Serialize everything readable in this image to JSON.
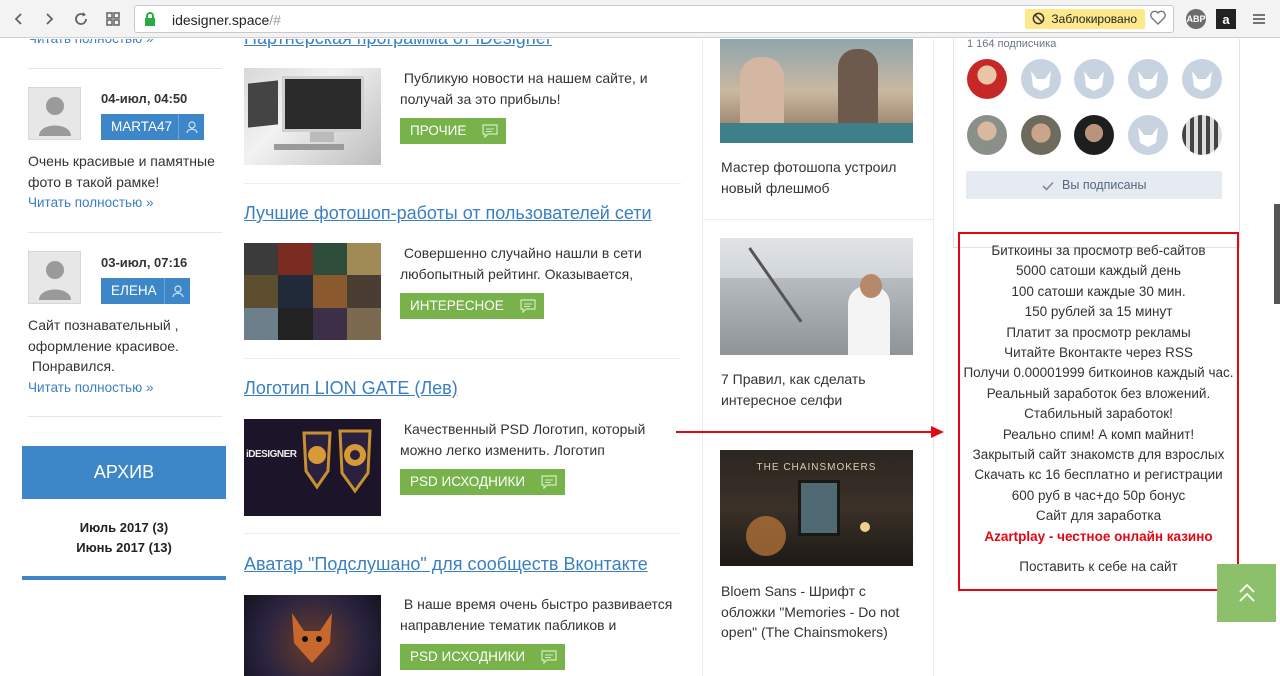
{
  "browser": {
    "url_host": "idesigner.space",
    "url_path": "/#",
    "blocked_label": "Заблокировано",
    "ext_abp": "ABP",
    "ext_amazon": "a"
  },
  "left": {
    "read_more": "Читать полностью »",
    "comments": [
      {
        "date": "04-июл, 04:50",
        "user": "MARTA47",
        "text_lines": [
          "Очень красивые и памятные",
          "фото в такой рамке!"
        ]
      },
      {
        "date": "03-июл, 07:16",
        "user": "ЕЛЕНА",
        "text_lines": [
          "Сайт познавательный ,",
          "оформление красивое.",
          " Понравился."
        ]
      }
    ],
    "archive": {
      "title": "АРХИВ",
      "items": [
        "Июль 2017 (3)",
        "Июнь 2017 (13)"
      ]
    }
  },
  "posts": {
    "partial_title": "Партнерская программа от iDesigner",
    "items": [
      {
        "title": "",
        "excerpt_lines": [
          " Публикую новости на нашем сайте, и",
          "получай за это прибыль!"
        ],
        "category": "ПРОЧИЕ"
      },
      {
        "title": "Лучшие фотошоп-работы от пользователей сети",
        "excerpt_lines": [
          " Совершенно случайно нашли в сети",
          "любопытный рейтинг. Оказывается,"
        ],
        "category": "ИНТЕРЕСНОЕ"
      },
      {
        "title": "Логотип LION GATE (Лев)",
        "excerpt_lines": [
          " Качественный PSD Логотип, который",
          "можно легко изменить. Логотип"
        ],
        "category": "PSD ИСХОДНИКИ",
        "thumb_text": "iDESIGNER"
      },
      {
        "title": "Аватар \"Подслушано\" для сообществ Вконтакте",
        "excerpt_lines": [
          " В наше время очень быстро развивается",
          "направление тематик пабликов и"
        ],
        "category": "PSD ИСХОДНИКИ"
      }
    ]
  },
  "right_posts": [
    {
      "title_lines": [
        "Мастер фотошопа устроил",
        "новый флешмоб"
      ]
    },
    {
      "title_lines": [
        "7 Правил, как сделать",
        "интересное селфи"
      ]
    },
    {
      "title_lines": [
        "Bloem Sans - Шрифт с",
        "обложки \"Memories - Do not",
        "open\" (The Chainsmokers)"
      ],
      "thumb_text": "THE CHAINSMOKERS"
    }
  ],
  "vk": {
    "subscribers": "1 164 подписчика",
    "subscribed_label": "Вы подписаны"
  },
  "ad": {
    "lines": [
      "Биткоины за просмотр веб-сайтов",
      "5000 сатоши каждый день",
      "100 сатоши каждые 30 мин.",
      "150 рублей за 15 минут",
      "Платит за просмотр рекламы",
      "Читайте Вконтакте через RSS",
      "Получи 0.00001999 биткоинов каждый час.",
      "Реальный заработок без вложений.",
      "Стабильный заработок!",
      "Реально спим! А комп майнит!",
      "Закрытый сайт знакомств для взрослых",
      "Скачать кс 16 бесплатно и регистрации",
      "600 руб в час+до 50р бонус",
      "Сайт для заработка"
    ],
    "highlight": "Azartplay - честное онлайн казино",
    "place_link": "Поставить к себе на сайт"
  },
  "colors": {
    "blue": "#3d87c9",
    "green": "#77b34a",
    "red": "#e30613",
    "link": "#3a7fc1"
  }
}
